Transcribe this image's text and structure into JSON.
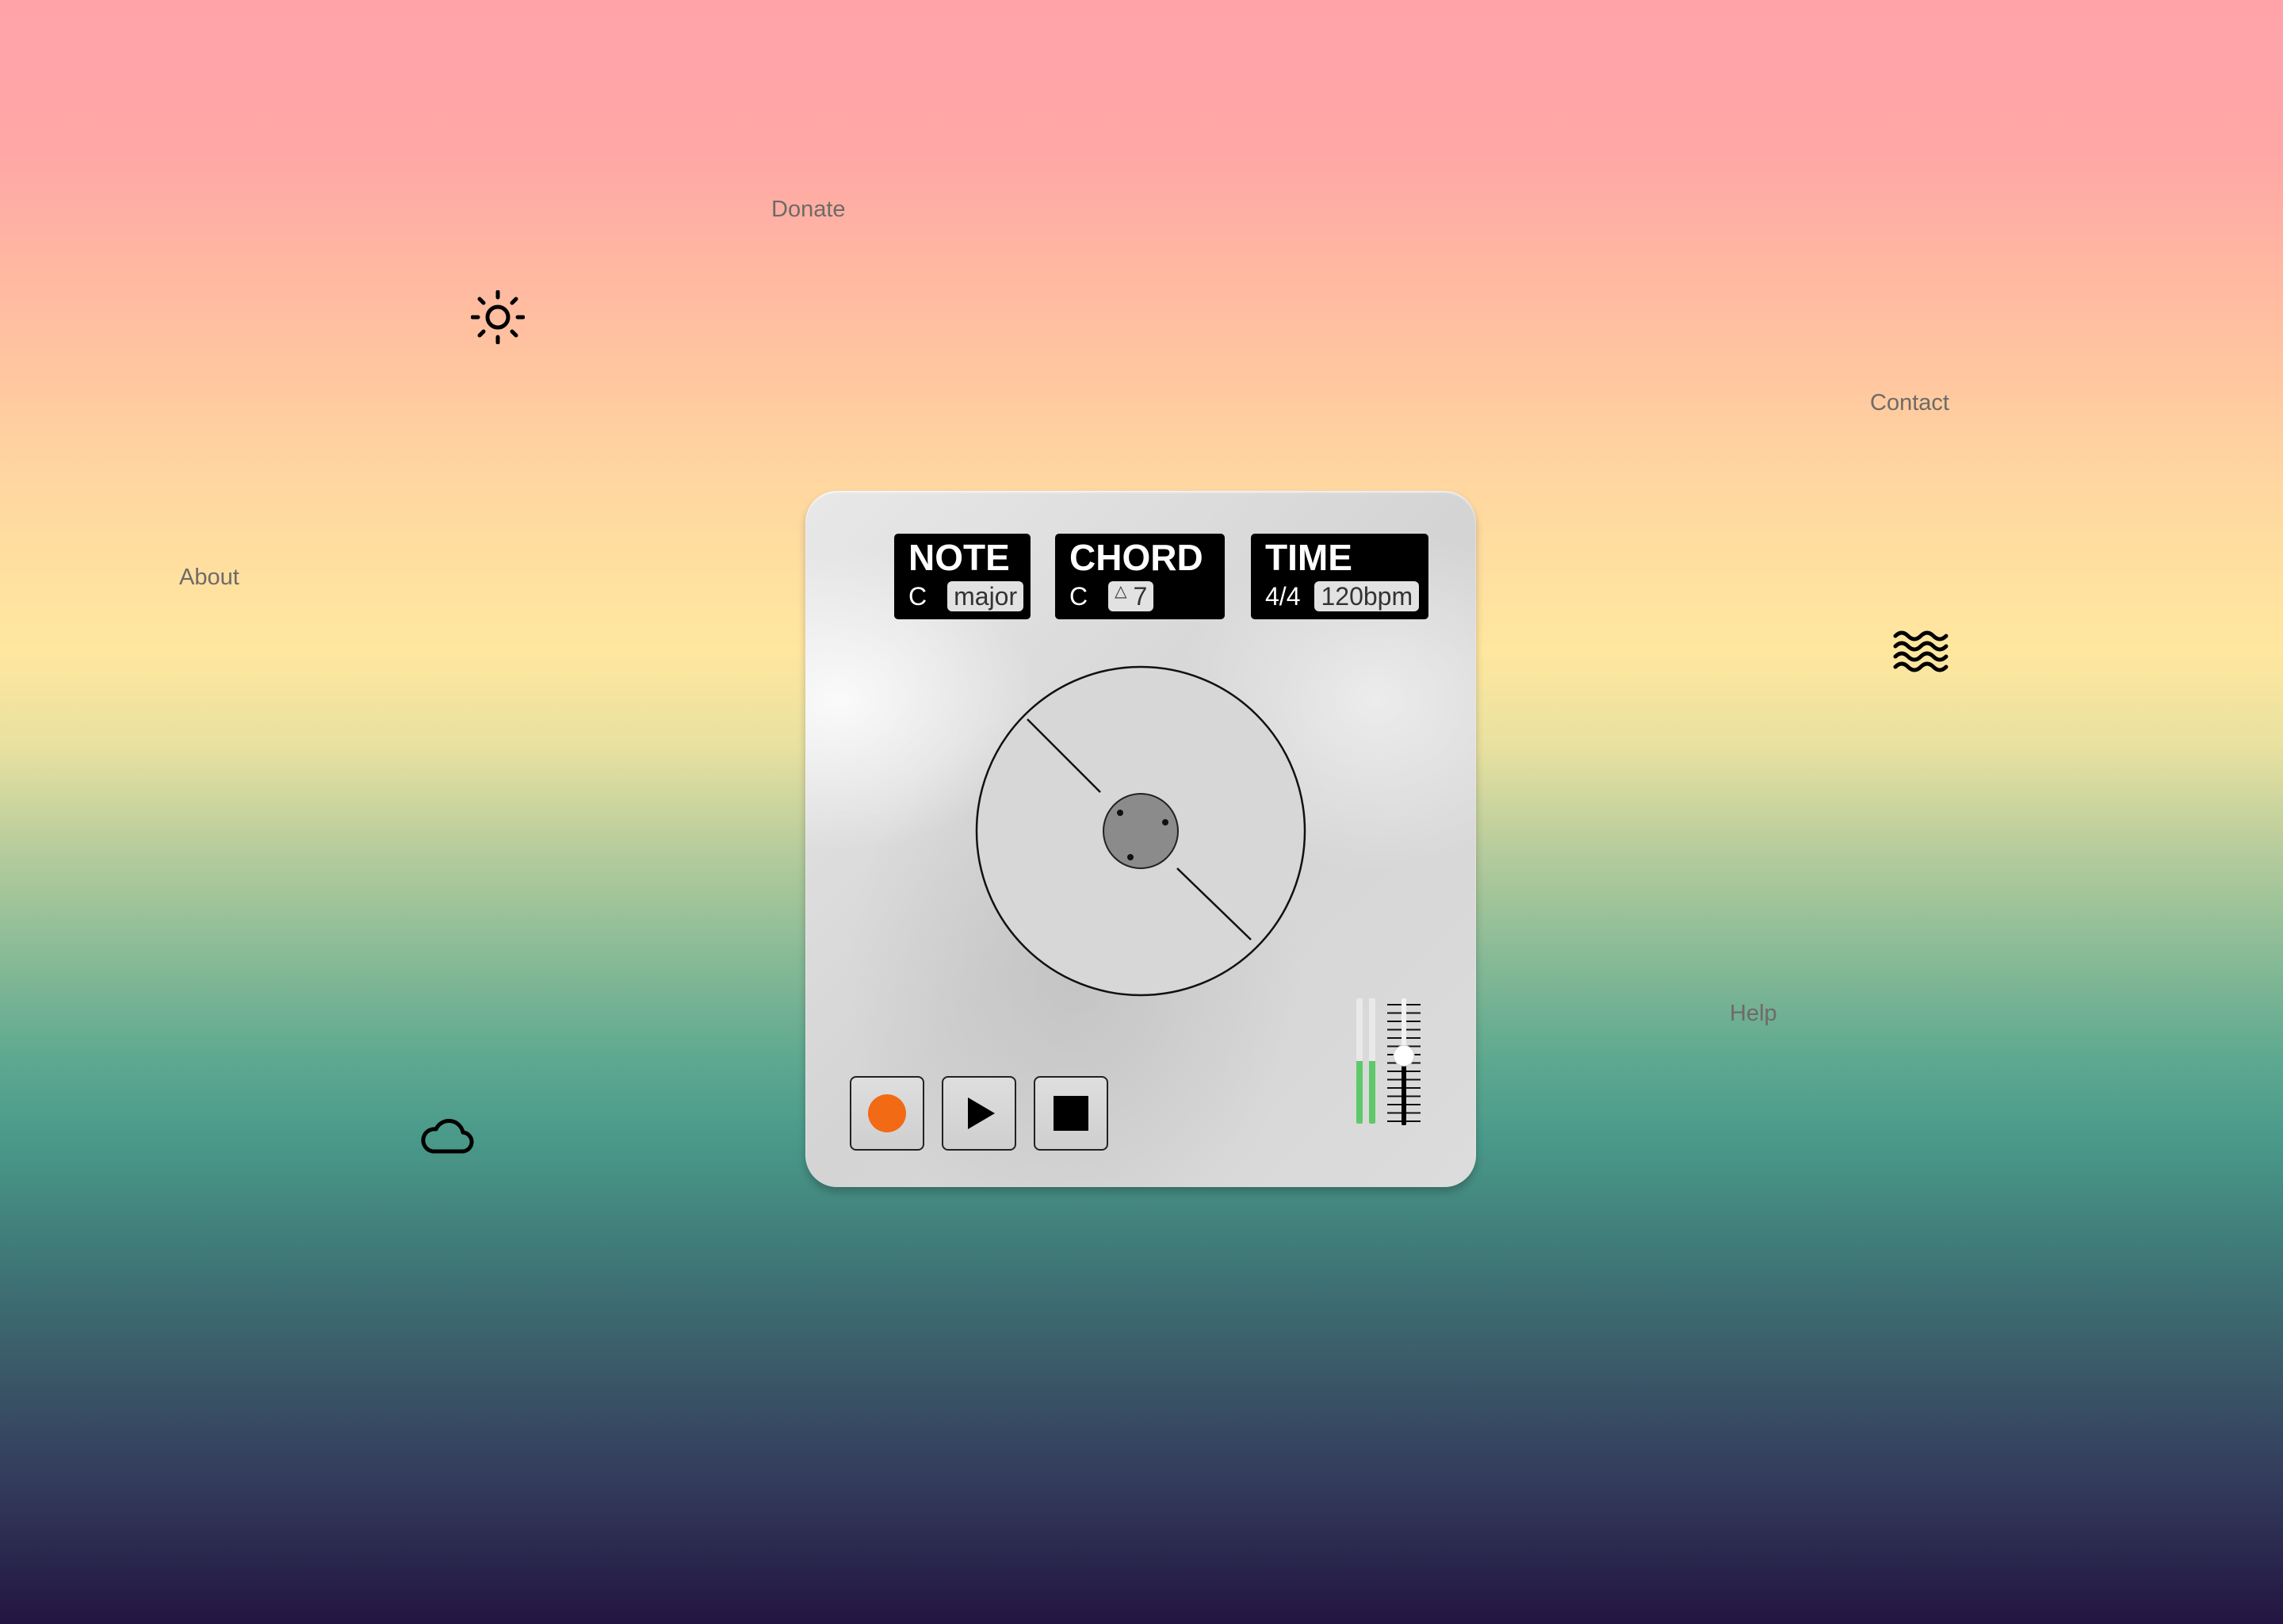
{
  "nav": {
    "donate": "Donate",
    "contact": "Contact",
    "about": "About",
    "help": "Help"
  },
  "icons": {
    "sun": "sun-icon",
    "waves": "waves-icon",
    "cloud": "cloud-icon"
  },
  "player": {
    "note": {
      "title": "NOTE",
      "value": "C",
      "option": "major"
    },
    "chord": {
      "title": "CHORD",
      "value": "C",
      "option_symbol": "△",
      "option": "7"
    },
    "time": {
      "title": "TIME",
      "value": "4/4",
      "option": "120bpm"
    },
    "transport": {
      "record_icon": "record-icon",
      "play_icon": "play-icon",
      "stop_icon": "stop-icon"
    },
    "levels": {
      "left": 0.5,
      "right": 0.5
    },
    "volume": 0.55
  },
  "colors": {
    "record": "#f26a14",
    "meter": "#5ec96a",
    "display_bg": "#000000"
  }
}
